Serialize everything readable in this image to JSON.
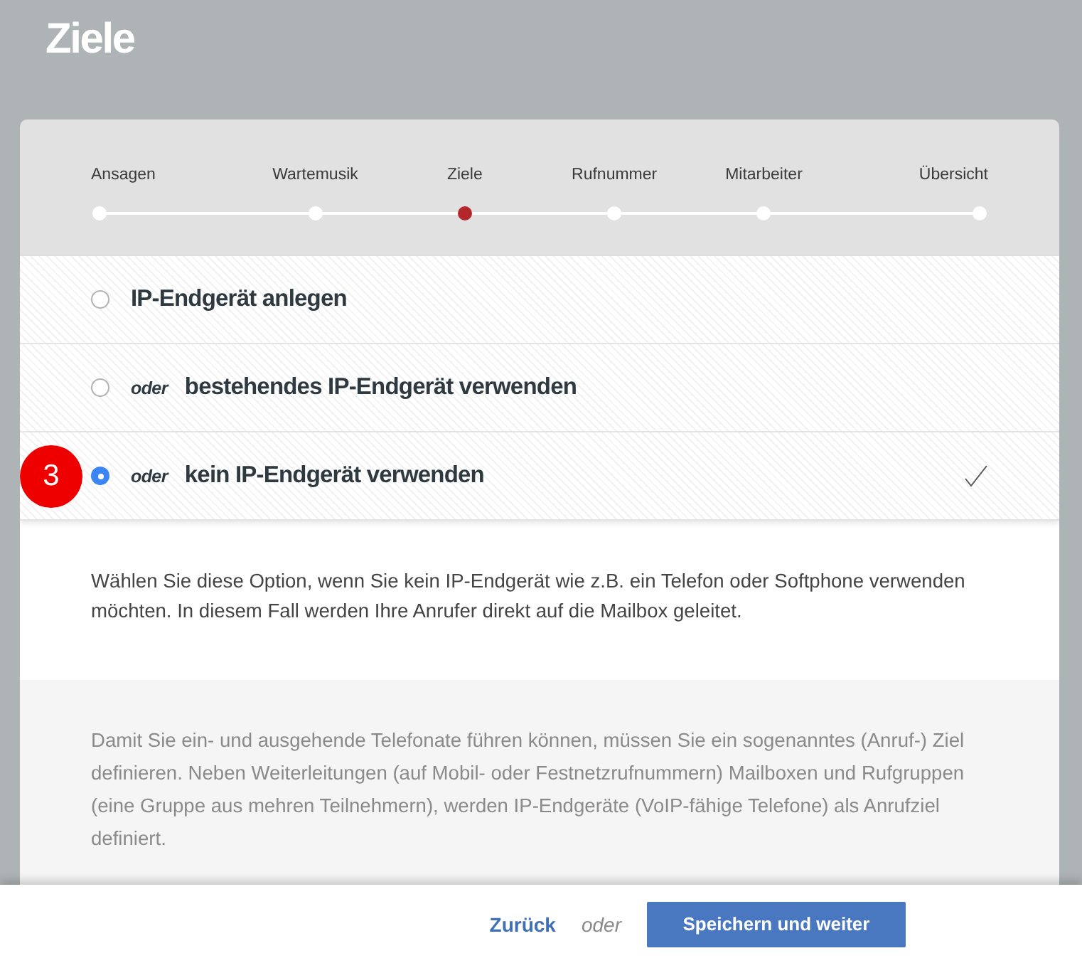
{
  "page": {
    "title": "Ziele"
  },
  "steps": [
    {
      "label": "Ansagen",
      "selected": false
    },
    {
      "label": "Wartemusik",
      "selected": false
    },
    {
      "label": "Ziele",
      "selected": true
    },
    {
      "label": "Rufnummer",
      "selected": false
    },
    {
      "label": "Mitarbeiter",
      "selected": false
    },
    {
      "label": "Übersicht",
      "selected": false
    }
  ],
  "options": [
    {
      "label": "IP-Endgerät anlegen",
      "selected": false
    },
    {
      "prefix": "oder",
      "label": "bestehendes IP-Endgerät verwenden",
      "selected": false
    },
    {
      "prefix": "oder",
      "label": "kein IP-Endgerät verwenden",
      "selected": true,
      "badge": "3"
    }
  ],
  "description": "Wählen Sie diese Option, wenn Sie kein IP-Endgerät wie z.B. ein Telefon oder Softphone verwenden möchten. In diesem Fall werden Ihre Anrufer direkt auf die Mailbox geleitet.",
  "info": "Damit Sie ein- und ausgehende Telefonate führen können, müssen Sie ein sogenanntes (Anruf-) Ziel definieren. Neben Weiterleitungen (auf Mobil- oder Festnetzrufnummern) Mailboxen und Rufgruppen (eine Gruppe aus mehren Teilnehmern), werden IP-Endgeräte (VoIP-fähige Telefone) als Anrufziel definiert.",
  "footer": {
    "back": "Zurück",
    "separator": "oder",
    "primary": "Speichern und weiter"
  }
}
